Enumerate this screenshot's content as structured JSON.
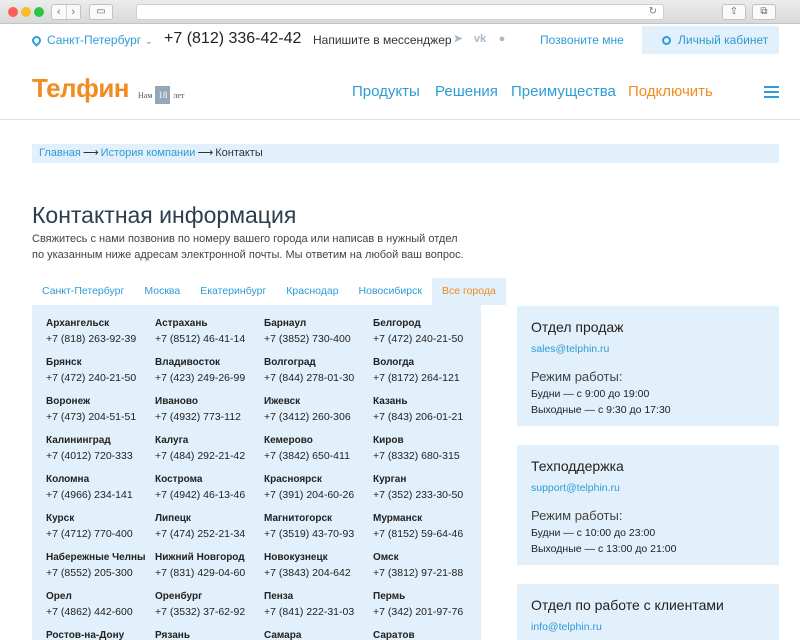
{
  "topbar": {
    "city": "Санкт-Петербург",
    "phone": "+7 (812) 336-42-42",
    "messenger_text": "Напишите в мессенджер",
    "messenger_icons": [
      "telegram-icon",
      "vk-icon",
      "messenger-icon"
    ],
    "call_me": "Позвоните мне",
    "cabinet": "Личный кабинет"
  },
  "header": {
    "logo": "Телфин",
    "years_prefix": "Нам",
    "years_number": "18",
    "years_suffix": "лет",
    "menu": [
      "Продукты",
      "Решения",
      "Преимущества",
      "Подключить"
    ]
  },
  "breadcrumb": [
    "Главная",
    "История компании",
    "Контакты"
  ],
  "main": {
    "title": "Контактная информация",
    "intro": "Свяжитесь с нами позвонив по номеру вашего города или написав в нужный отдел по указанным ниже адресам электронной почты. Мы ответим на любой ваш вопрос."
  },
  "tabs": [
    "Санкт-Петербург",
    "Москва",
    "Екатеринбург",
    "Краснодар",
    "Новосибирск",
    "Все города"
  ],
  "active_tab": "Все города",
  "cities": [
    {
      "name": "Архангельск",
      "phone": "+7 (818) 263-92-39"
    },
    {
      "name": "Астрахань",
      "phone": "+7 (8512) 46-41-14"
    },
    {
      "name": "Барнаул",
      "phone": "+7 (3852) 730-400"
    },
    {
      "name": "Белгород",
      "phone": "+7 (472) 240-21-50"
    },
    {
      "name": "Брянск",
      "phone": "+7 (472) 240-21-50"
    },
    {
      "name": "Владивосток",
      "phone": "+7 (423) 249-26-99"
    },
    {
      "name": "Волгоград",
      "phone": "+7 (844) 278-01-30"
    },
    {
      "name": "Вологда",
      "phone": "+7 (8172) 264-121"
    },
    {
      "name": "Воронеж",
      "phone": "+7 (473) 204-51-51"
    },
    {
      "name": "Иваново",
      "phone": "+7 (4932) 773-112"
    },
    {
      "name": "Ижевск",
      "phone": "+7 (3412) 260-306"
    },
    {
      "name": "Казань",
      "phone": "+7 (843) 206-01-21"
    },
    {
      "name": "Калининград",
      "phone": "+7 (4012) 720-333"
    },
    {
      "name": "Калуга",
      "phone": "+7 (484) 292-21-42"
    },
    {
      "name": "Кемерово",
      "phone": "+7 (3842) 650-411"
    },
    {
      "name": "Киров",
      "phone": "+7 (8332) 680-315"
    },
    {
      "name": "Коломна",
      "phone": "+7 (4966) 234-141"
    },
    {
      "name": "Кострома",
      "phone": "+7 (4942) 46-13-46"
    },
    {
      "name": "Красноярск",
      "phone": "+7 (391) 204-60-26"
    },
    {
      "name": "Курган",
      "phone": "+7 (352) 233-30-50"
    },
    {
      "name": "Курск",
      "phone": "+7 (4712) 770-400"
    },
    {
      "name": "Липецк",
      "phone": "+7 (474) 252-21-34"
    },
    {
      "name": "Магнитогорск",
      "phone": "+7 (3519) 43-70-93"
    },
    {
      "name": "Мурманск",
      "phone": "+7 (8152) 59-64-46"
    },
    {
      "name": "Набережные Челны",
      "phone": "+7 (8552) 205-300"
    },
    {
      "name": "Нижний Новгород",
      "phone": "+7 (831) 429-04-60"
    },
    {
      "name": "Новокузнецк",
      "phone": "+7 (3843) 204-642"
    },
    {
      "name": "Омск",
      "phone": "+7 (3812) 97-21-88"
    },
    {
      "name": "Орел",
      "phone": "+7 (4862) 442-600"
    },
    {
      "name": "Оренбург",
      "phone": "+7 (3532) 37-62-92"
    },
    {
      "name": "Пенза",
      "phone": "+7 (841) 222-31-03"
    },
    {
      "name": "Пермь",
      "phone": "+7 (342) 201-97-76"
    },
    {
      "name": "Ростов-на-Дону",
      "phone": ""
    },
    {
      "name": "Рязань",
      "phone": ""
    },
    {
      "name": "Самара",
      "phone": ""
    },
    {
      "name": "Саратов",
      "phone": ""
    }
  ],
  "departments": [
    {
      "name": "Отдел продаж",
      "email": "sales@telphin.ru",
      "hours_title": "Режим работы:",
      "weekdays": "Будни — с 9:00 до 19:00",
      "weekends": "Выходные — с 9:30 до 17:30"
    },
    {
      "name": "Техподдержка",
      "email": "support@telphin.ru",
      "hours_title": "Режим работы:",
      "weekdays": "Будни — с 10:00 до 23:00",
      "weekends": "Выходные — с 13:00 до 21:00"
    },
    {
      "name": "Отдел по работе с клиентами",
      "email": "info@telphin.ru",
      "hours_title": "",
      "weekdays": "",
      "weekends": ""
    }
  ],
  "colors": {
    "accent": "#2d9cd7",
    "brand": "#f28b21",
    "panel": "#e1f0fa"
  }
}
